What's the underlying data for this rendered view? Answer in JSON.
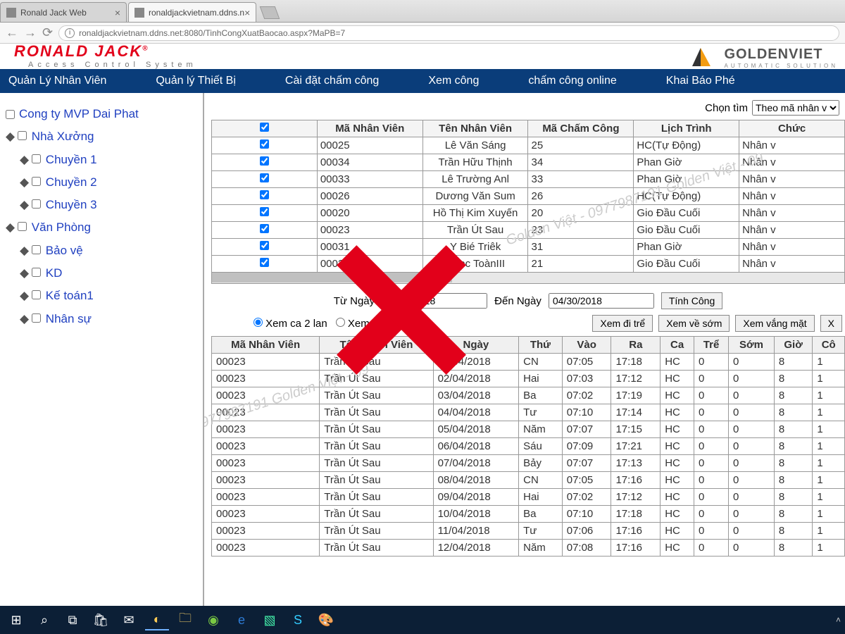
{
  "browser": {
    "tabs": [
      {
        "title": "Ronald Jack Web",
        "active": false
      },
      {
        "title": "ronaldjackvietnam.ddns.n",
        "active": true
      }
    ],
    "url": "ronaldjackvietnam.ddns.net:8080/TinhCongXuatBaocao.aspx?MaPB=7"
  },
  "brand": {
    "logo": "RONALD JACK",
    "reg": "®",
    "tagline": "Access Control System",
    "partner": "GOLDENVIET",
    "partner_sub": "AUTOMATIC SOLUTION"
  },
  "nav": [
    "Quản Lý Nhân Viên",
    "Quản lý Thiết Bị",
    "Cài đặt chấm công",
    "Xem công",
    "chấm công online",
    "Khai Báo Phé"
  ],
  "tree": {
    "root": "Cong ty MVP Dai Phat",
    "nodes": [
      {
        "label": "Nhà Xưởng",
        "children": [
          "Chuyền 1",
          "Chuyền 2",
          "Chuyền 3"
        ]
      },
      {
        "label": "Văn Phòng",
        "children": [
          "Bảo vệ",
          "KD",
          "Kế toán1",
          "Nhân sự"
        ]
      }
    ]
  },
  "filter": {
    "label": "Chọn tìm",
    "option": "Theo mã nhân v"
  },
  "grid1": {
    "headers": [
      "",
      "Mã Nhân Viên",
      "Tên Nhân Viên",
      "Mã Chấm Công",
      "Lịch Trình",
      "Chức"
    ],
    "rows": [
      [
        "00025",
        "Lê Văn Sáng",
        "25",
        "HC(Tự Động)",
        "Nhân v"
      ],
      [
        "00034",
        "Trần Hữu Thịnh",
        "34",
        "Phan Giờ",
        "Nhân v"
      ],
      [
        "00033",
        "Lê Trường Anl",
        "33",
        "Phan Giờ",
        "Nhân v"
      ],
      [
        "00026",
        "Dương Văn Sum",
        "26",
        "HC(Tự Động)",
        "Nhân v"
      ],
      [
        "00020",
        "Hồ Thị Kim Xuyến",
        "20",
        "Gio Đầu Cuối",
        "Nhân v"
      ],
      [
        "00023",
        "Trần Út Sau",
        "23",
        "Gio Đầu Cuối",
        "Nhân v"
      ],
      [
        "00031",
        "Y Bié Triêk",
        "31",
        "Phan Giờ",
        "Nhân v"
      ],
      [
        "00021",
        "Ngọc ToànIII",
        "21",
        "Gio Đầu Cuối",
        "Nhân v"
      ]
    ]
  },
  "daterange": {
    "from_label": "Từ Ngày",
    "from": "04/01/2018",
    "to_label": "Đến Ngày",
    "to": "04/30/2018",
    "calc_btn": "Tính Công"
  },
  "radios": {
    "opt1": "Xem ca 2 lan",
    "opt2": "Xem ca 6 lần"
  },
  "view_buttons": [
    "Xem đi trể",
    "Xem về sớm",
    "Xem vắng mặt",
    "X"
  ],
  "grid2": {
    "headers": [
      "Mã Nhân Viên",
      "Tên Nhân Viên",
      "Ngày",
      "Thứ",
      "Vào",
      "Ra",
      "Ca",
      "Trể",
      "Sớm",
      "Giờ",
      "Cô"
    ],
    "rows": [
      [
        "00023",
        "Trần Út Sau",
        "01/04/2018",
        "CN",
        "07:05",
        "17:18",
        "HC",
        "0",
        "0",
        "8",
        "1"
      ],
      [
        "00023",
        "Trần Út Sau",
        "02/04/2018",
        "Hai",
        "07:03",
        "17:12",
        "HC",
        "0",
        "0",
        "8",
        "1"
      ],
      [
        "00023",
        "Trần Út Sau",
        "03/04/2018",
        "Ba",
        "07:02",
        "17:19",
        "HC",
        "0",
        "0",
        "8",
        "1"
      ],
      [
        "00023",
        "Trần Út Sau",
        "04/04/2018",
        "Tư",
        "07:10",
        "17:14",
        "HC",
        "0",
        "0",
        "8",
        "1"
      ],
      [
        "00023",
        "Trần Út Sau",
        "05/04/2018",
        "Năm",
        "07:07",
        "17:15",
        "HC",
        "0",
        "0",
        "8",
        "1"
      ],
      [
        "00023",
        "Trần Út Sau",
        "06/04/2018",
        "Sáu",
        "07:09",
        "17:21",
        "HC",
        "0",
        "0",
        "8",
        "1"
      ],
      [
        "00023",
        "Trần Út Sau",
        "07/04/2018",
        "Bảy",
        "07:07",
        "17:13",
        "HC",
        "0",
        "0",
        "8",
        "1"
      ],
      [
        "00023",
        "Trần Út Sau",
        "08/04/2018",
        "CN",
        "07:05",
        "17:16",
        "HC",
        "0",
        "0",
        "8",
        "1"
      ],
      [
        "00023",
        "Trần Út Sau",
        "09/04/2018",
        "Hai",
        "07:02",
        "17:12",
        "HC",
        "0",
        "0",
        "8",
        "1"
      ],
      [
        "00023",
        "Trần Út Sau",
        "10/04/2018",
        "Ba",
        "07:10",
        "17:18",
        "HC",
        "0",
        "0",
        "8",
        "1"
      ],
      [
        "00023",
        "Trần Út Sau",
        "11/04/2018",
        "Tư",
        "07:06",
        "17:16",
        "HC",
        "0",
        "0",
        "8",
        "1"
      ],
      [
        "00023",
        "Trần Út Sau",
        "12/04/2018",
        "Năm",
        "07:08",
        "17:16",
        "HC",
        "0",
        "0",
        "8",
        "1"
      ]
    ]
  },
  "watermark": "Golden Việt - 0977987191 Golden Việt - 09"
}
